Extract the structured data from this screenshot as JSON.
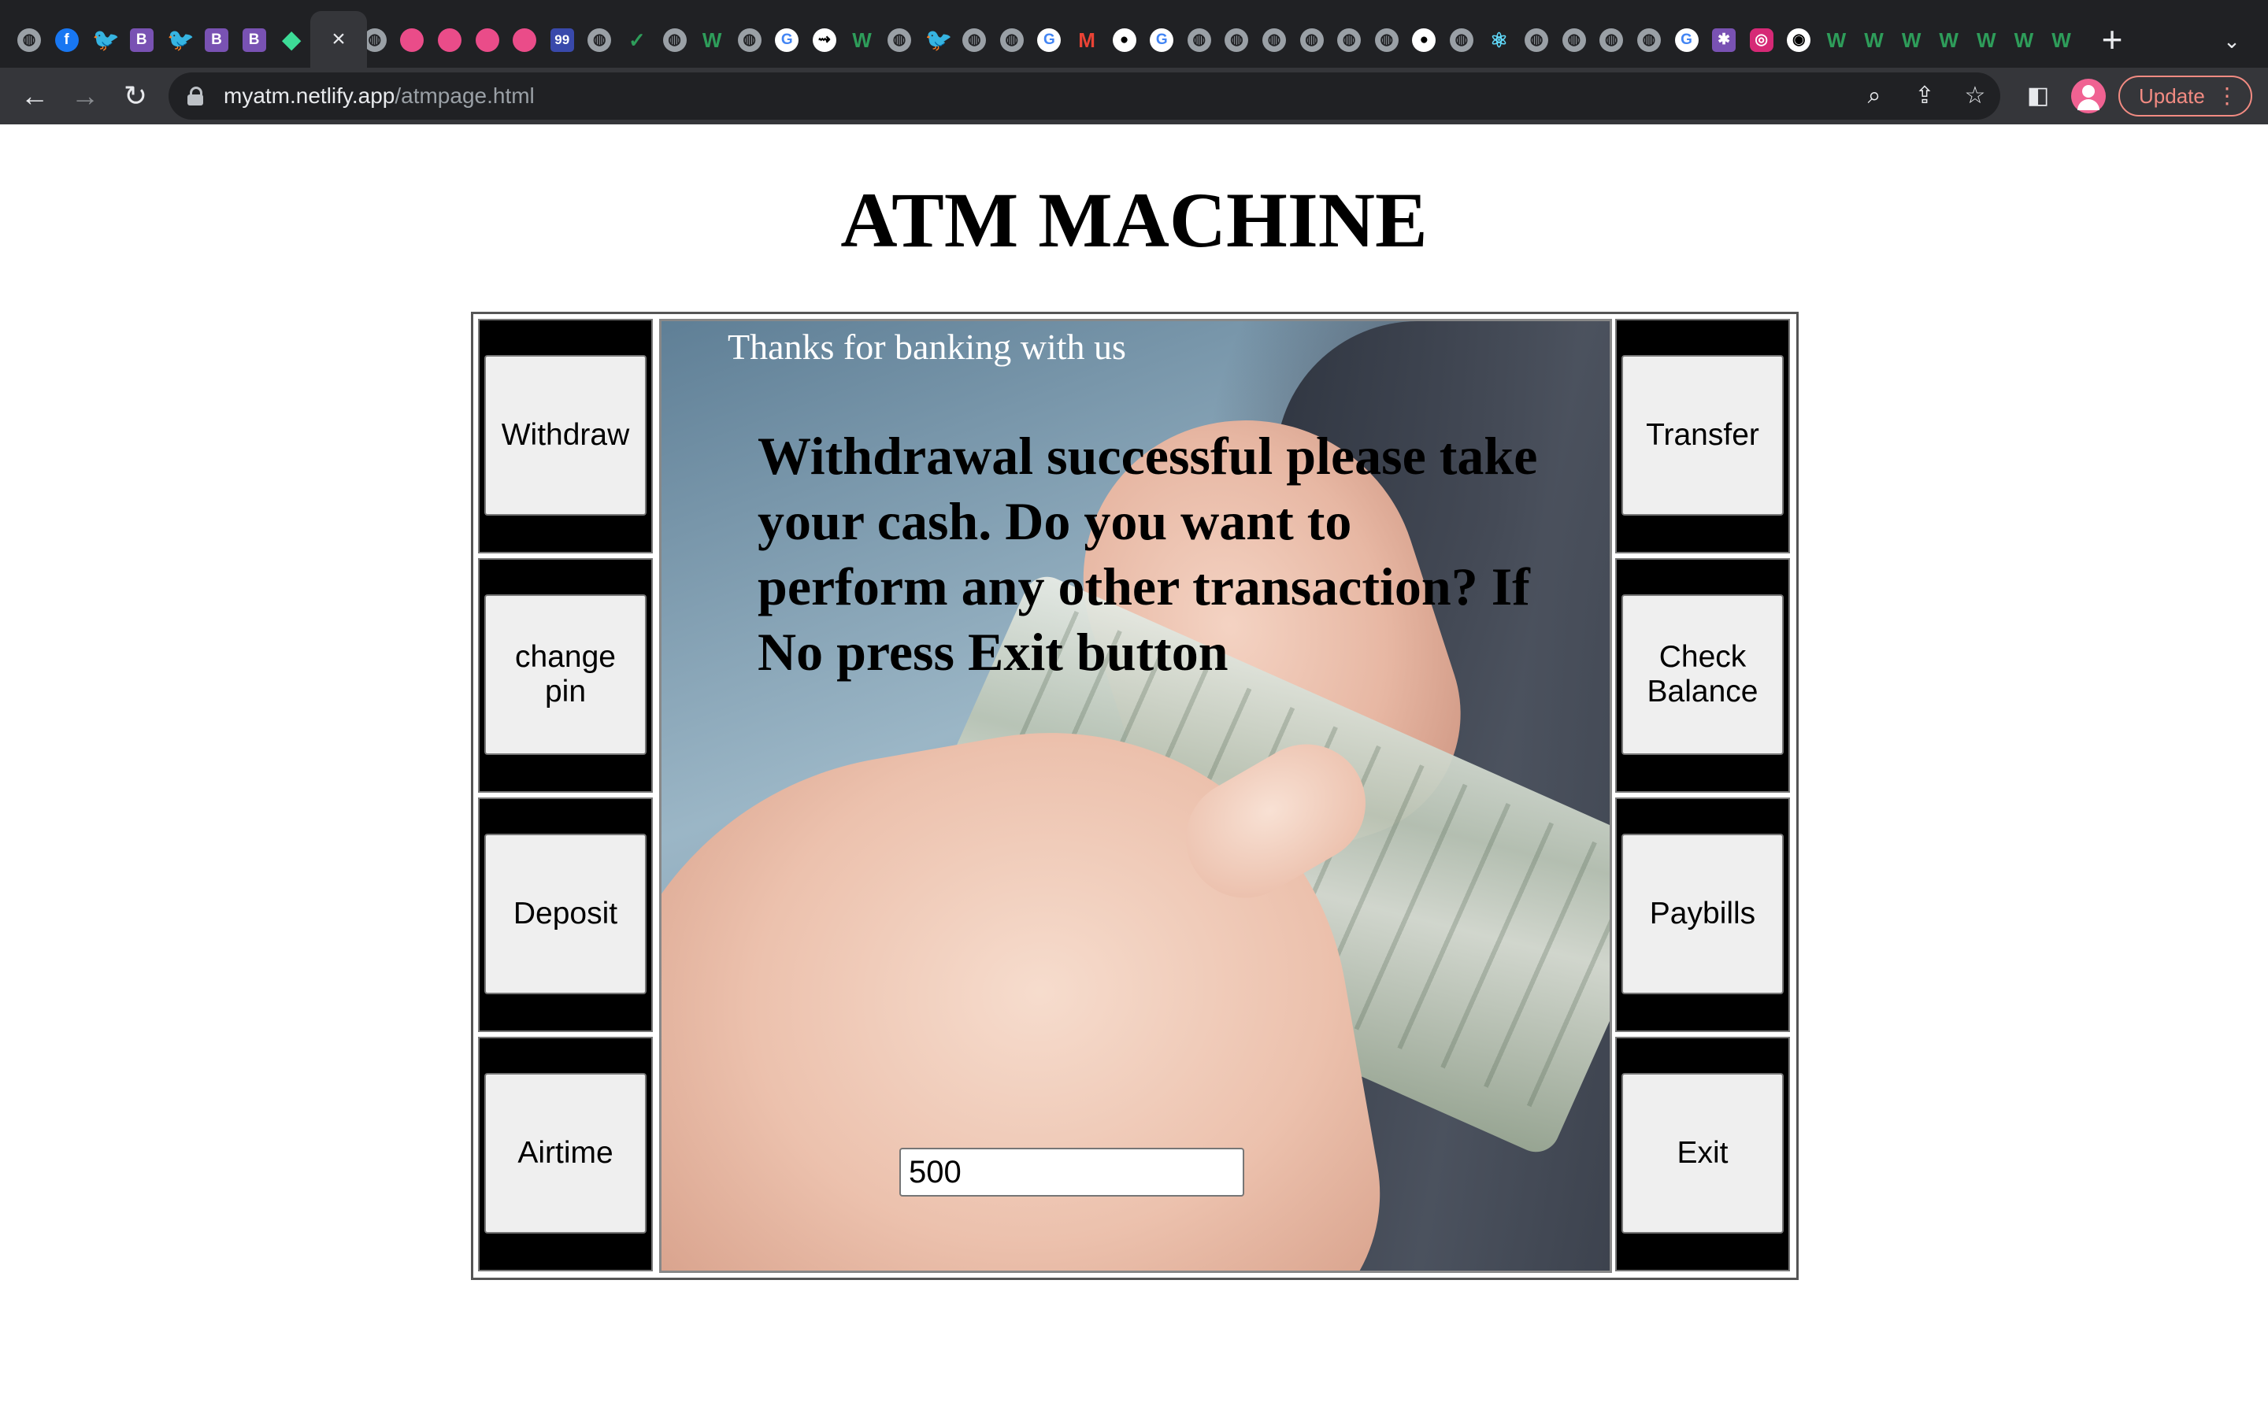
{
  "browser": {
    "tab_icons": [
      "globe-icon",
      "facebook-icon",
      "twitter-icon",
      "bootstrap-icon",
      "twitter-icon",
      "bootstrap-icon",
      "bootstrap-icon",
      "diamond-icon",
      "globe-icon",
      "dribbble-icon",
      "dribbble-icon",
      "dribbble-icon",
      "dribbble-icon",
      "ninety-nine-icon",
      "globe-icon",
      "swoosh-icon",
      "globe-icon",
      "w-icon",
      "globe-icon",
      "google-icon",
      "arrow-icon",
      "w-icon",
      "globe-icon",
      "twitter-icon",
      "globe-icon",
      "globe-icon",
      "google-icon",
      "gmail-icon",
      "github-icon",
      "google-icon",
      "globe-icon",
      "globe-icon",
      "globe-icon",
      "globe-icon",
      "globe-icon",
      "globe-icon",
      "github-icon",
      "globe-icon",
      "react-icon",
      "globe-icon",
      "globe-icon",
      "globe-icon",
      "globe-icon",
      "google-icon",
      "colorful-icon",
      "instagram-icon",
      "chrome-icon",
      "w-icon",
      "w-icon",
      "w-icon",
      "w-icon",
      "w-icon",
      "w-icon",
      "w-icon"
    ],
    "active_tab_close": "×",
    "new_tab": "+",
    "tab_search": "⌄",
    "url_host": "myatm.netlify.app",
    "url_path": "/atmpage.html",
    "update_label": "Update",
    "accent_color": "#f28b82"
  },
  "page": {
    "title": "ATM MACHINE"
  },
  "atm": {
    "left_buttons": [
      "Withdraw",
      "change pin",
      "Deposit",
      "Airtime"
    ],
    "right_buttons": [
      "Transfer",
      "Check Balance",
      "Paybills",
      "Exit"
    ],
    "screen": {
      "greeting": "Thanks for banking with us",
      "message": "Withdrawal successful please take your cash. Do you want to perform any other transaction? If No press Exit button",
      "amount_value": "500"
    }
  }
}
